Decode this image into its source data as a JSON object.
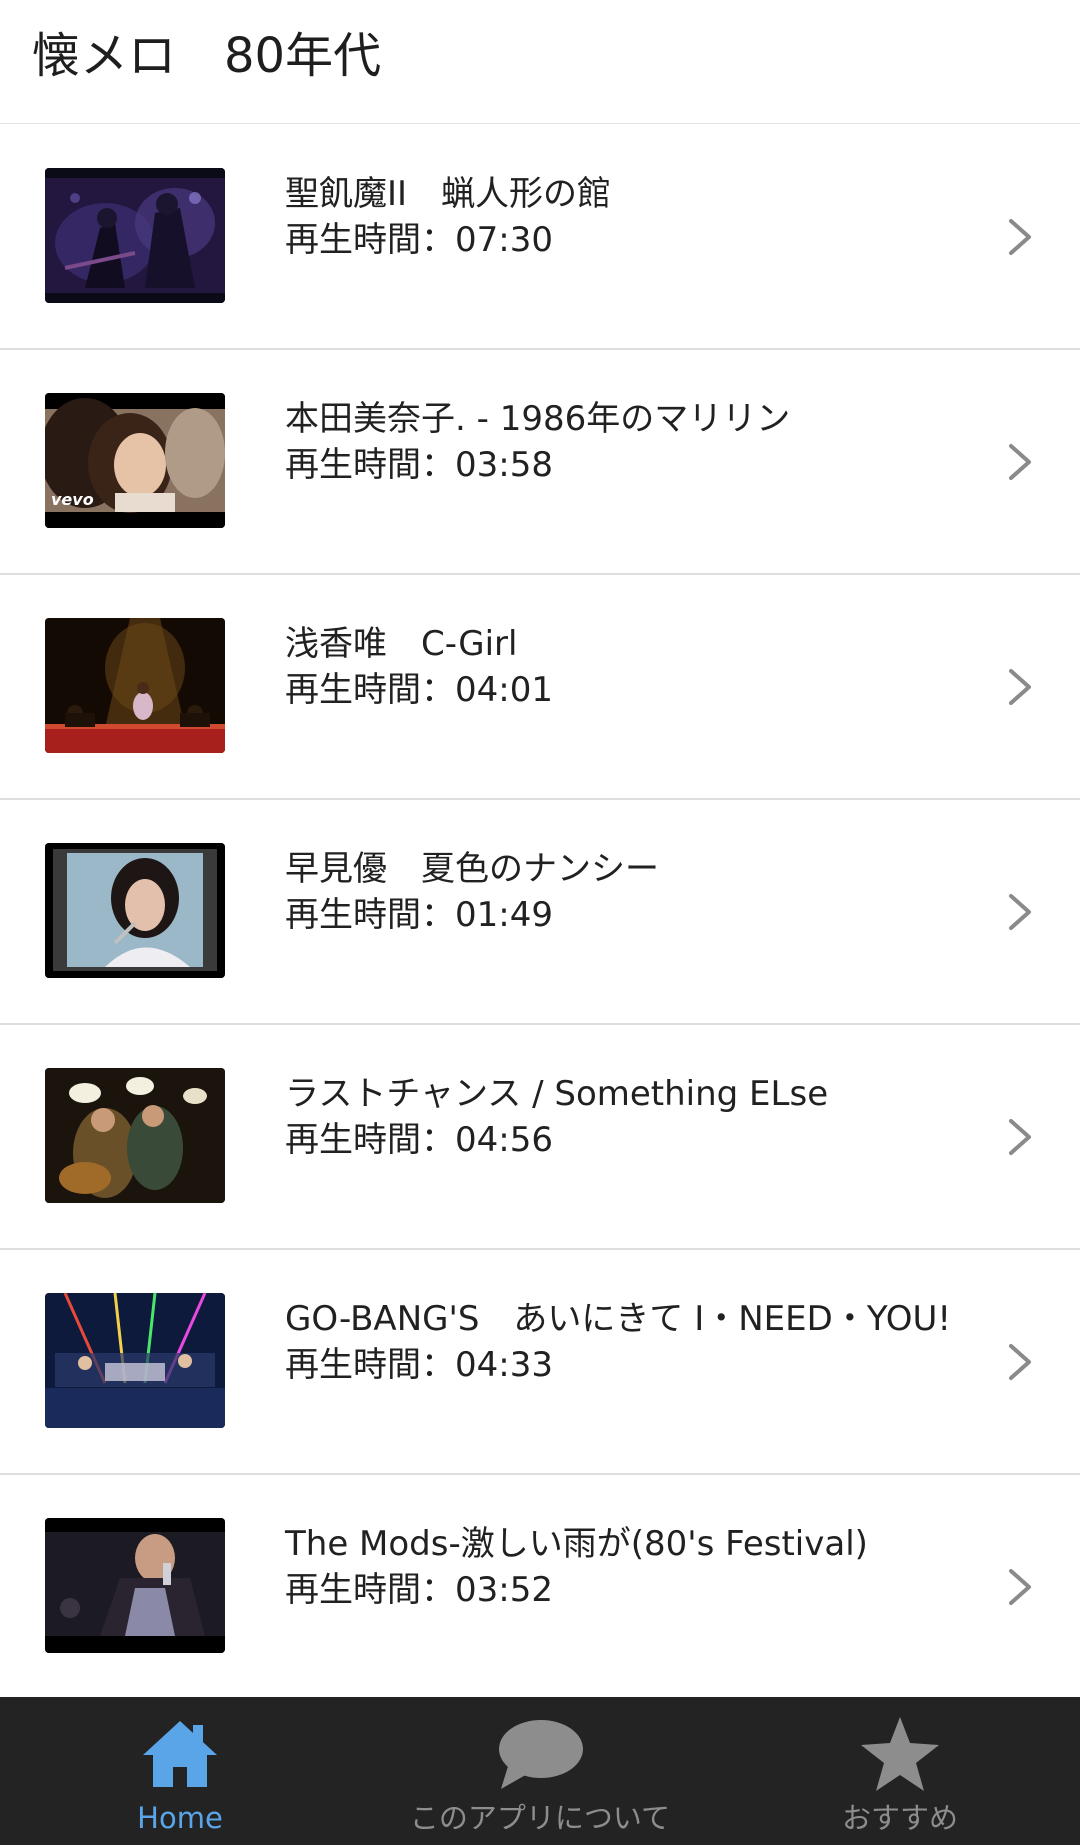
{
  "header": {
    "title": "懐メロ　80年代"
  },
  "songs": [
    {
      "title": "聖飢魔II　蝋人形の館",
      "duration": "再生時間：07:30",
      "thumb": "concert-purple-thumbnail"
    },
    {
      "title": "本田美奈子. - 1986年のマリリン",
      "duration": "再生時間：03:58",
      "thumb": "portrait-vevo-thumbnail",
      "thumb_caption": "vevo"
    },
    {
      "title": "浅香唯　C-Girl",
      "duration": "再生時間：04:01",
      "thumb": "stage-red-thumbnail"
    },
    {
      "title": "早見優　夏色のナンシー",
      "duration": "再生時間：01:49",
      "thumb": "singer-closeup-thumbnail"
    },
    {
      "title": "ラストチャンス / Something ELse",
      "duration": "再生時間：04:56",
      "thumb": "guitar-duo-thumbnail"
    },
    {
      "title": "GO-BANG'S　あいにきて I・NEED・YOU!",
      "duration": "再生時間：04:33",
      "thumb": "band-stage-lights-thumbnail"
    },
    {
      "title": "The Mods-激しい雨が(80's Festival)",
      "duration": "再生時間：03:52",
      "thumb": "vocalist-live-thumbnail"
    }
  ],
  "bottom_nav": {
    "items": [
      {
        "label": "Home",
        "icon": "home-icon",
        "active": true
      },
      {
        "label": "このアプリについて",
        "icon": "speech-bubble-icon",
        "active": false
      },
      {
        "label": "おすすめ",
        "icon": "star-icon",
        "active": false
      }
    ]
  },
  "colors": {
    "accent": "#5aa4e8",
    "nav_background": "#232323",
    "nav_inactive": "#8d8d8d",
    "divider": "#dedede"
  }
}
